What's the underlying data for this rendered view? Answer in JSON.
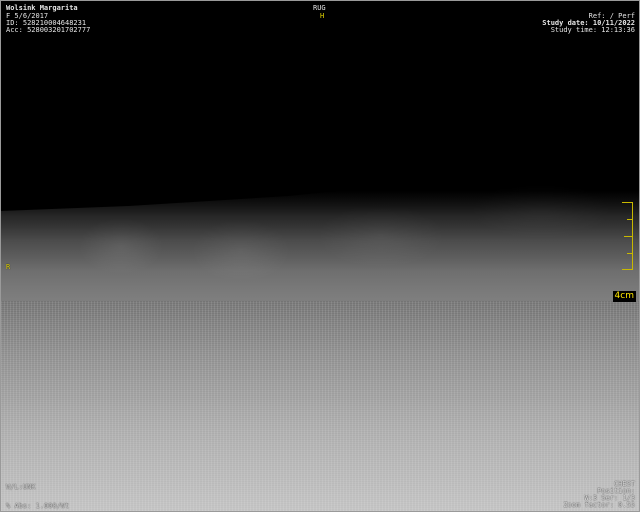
{
  "patient": {
    "name": "Wolsink Margarita",
    "sex_dob": "F 5/6/2017",
    "id": "ID: 528210004648231",
    "acc": "Acc: 528003201702777"
  },
  "orientation": {
    "top_label": "RUG",
    "top_marker": "H",
    "left_marker": "R"
  },
  "study": {
    "ref": "Ref: / Perf",
    "date": "Study date: 10/11/2022",
    "time": "Study time: 12:13:36"
  },
  "scale": {
    "label": "4cm"
  },
  "bottom_left": {
    "line1": "W/L:UNK",
    "line2": "% Abs: 1.000/Wt"
  },
  "bottom_right": {
    "line1": "CHEST",
    "line2": "Position:",
    "line3": "W:3 Ser: 1/3",
    "line4": "Zoom factor: 0.55"
  },
  "colors": {
    "overlay_text": "#e6e6e6",
    "marker_yellow": "#e2d400",
    "scale_label": "#ffe800"
  }
}
